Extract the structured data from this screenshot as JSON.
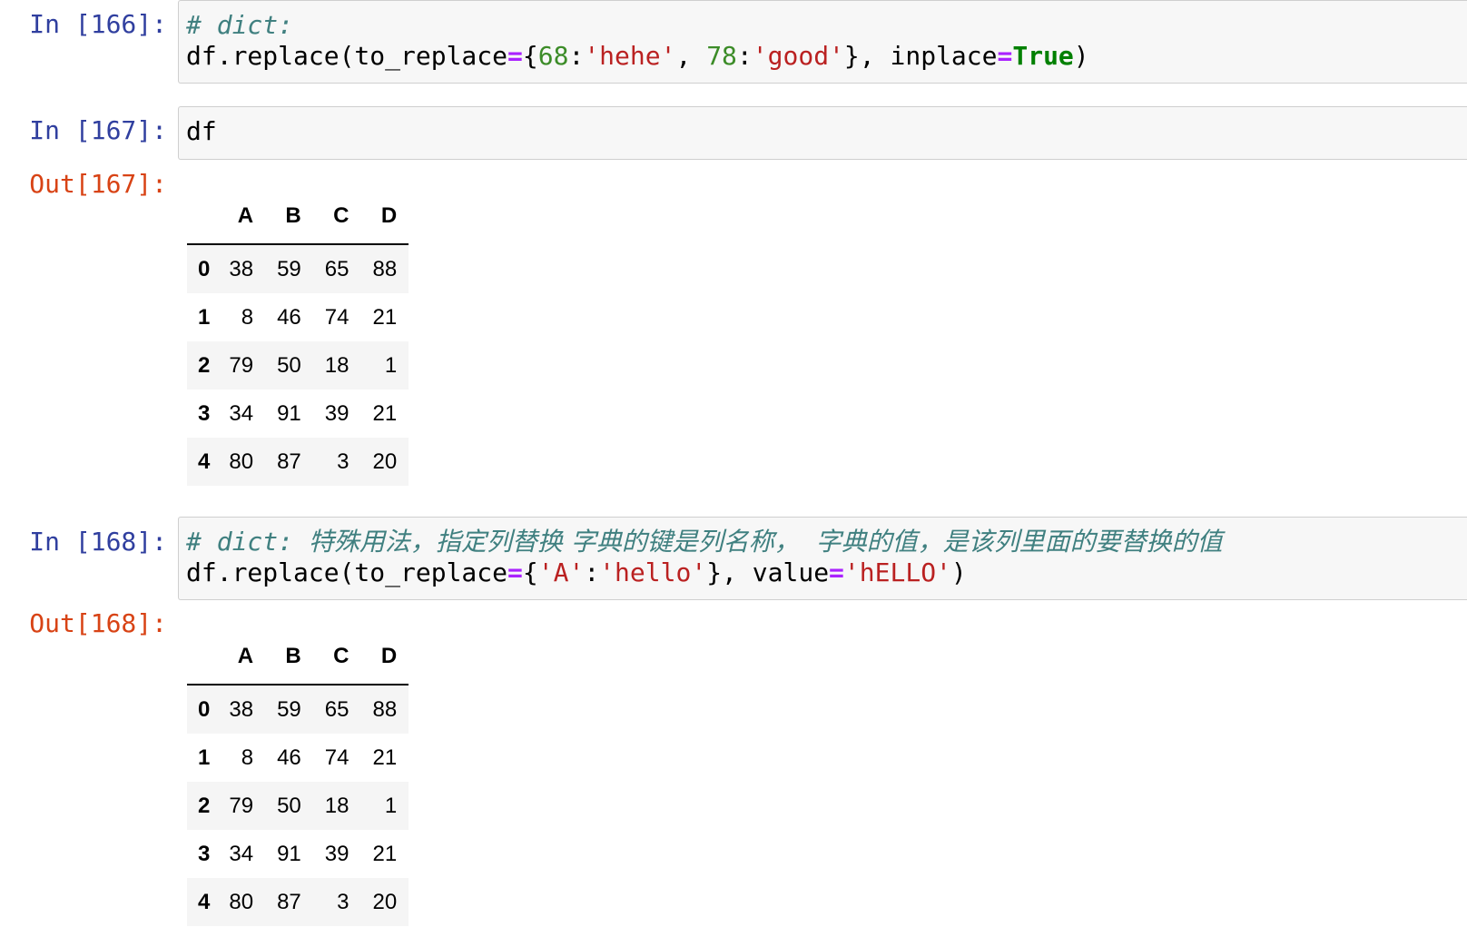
{
  "cells": [
    {
      "in_prompt": "In [166]:",
      "code_lines": [
        [
          {
            "t": "comment",
            "v": "# dict:"
          }
        ],
        [
          {
            "t": "plain",
            "v": "df.replace(to_replace"
          },
          {
            "t": "op",
            "v": "="
          },
          {
            "t": "plain",
            "v": "{"
          },
          {
            "t": "num",
            "v": "68"
          },
          {
            "t": "plain",
            "v": ":"
          },
          {
            "t": "str",
            "v": "'hehe'"
          },
          {
            "t": "plain",
            "v": ", "
          },
          {
            "t": "num",
            "v": "78"
          },
          {
            "t": "plain",
            "v": ":"
          },
          {
            "t": "str",
            "v": "'good'"
          },
          {
            "t": "plain",
            "v": "}, inplace"
          },
          {
            "t": "op",
            "v": "="
          },
          {
            "t": "kw",
            "v": "True"
          },
          {
            "t": "plain",
            "v": ")"
          }
        ]
      ]
    },
    {
      "in_prompt": "In [167]:",
      "code_lines": [
        [
          {
            "t": "plain",
            "v": "df"
          }
        ]
      ],
      "out_prompt": "Out[167]:",
      "table": {
        "columns": [
          "A",
          "B",
          "C",
          "D"
        ],
        "rows": [
          {
            "index": "0",
            "values": [
              "38",
              "59",
              "65",
              "88"
            ]
          },
          {
            "index": "1",
            "values": [
              "8",
              "46",
              "74",
              "21"
            ]
          },
          {
            "index": "2",
            "values": [
              "79",
              "50",
              "18",
              "1"
            ]
          },
          {
            "index": "3",
            "values": [
              "34",
              "91",
              "39",
              "21"
            ]
          },
          {
            "index": "4",
            "values": [
              "80",
              "87",
              "3",
              "20"
            ]
          }
        ]
      }
    },
    {
      "in_prompt": "In [168]:",
      "code_lines": [
        [
          {
            "t": "comment",
            "v": "# dict: "
          },
          {
            "t": "comment-cjk",
            "v": "特殊用法，指定列替换 字典的键是列名称，  字典的值，是该列里面的要替换的值"
          }
        ],
        [
          {
            "t": "plain",
            "v": "df.replace(to_replace"
          },
          {
            "t": "op",
            "v": "="
          },
          {
            "t": "plain",
            "v": "{"
          },
          {
            "t": "str",
            "v": "'A'"
          },
          {
            "t": "plain",
            "v": ":"
          },
          {
            "t": "str",
            "v": "'hello'"
          },
          {
            "t": "plain",
            "v": "}, value"
          },
          {
            "t": "op",
            "v": "="
          },
          {
            "t": "str",
            "v": "'hELLO'"
          },
          {
            "t": "plain",
            "v": ")"
          }
        ]
      ],
      "out_prompt": "Out[168]:",
      "table": {
        "columns": [
          "A",
          "B",
          "C",
          "D"
        ],
        "rows": [
          {
            "index": "0",
            "values": [
              "38",
              "59",
              "65",
              "88"
            ]
          },
          {
            "index": "1",
            "values": [
              "8",
              "46",
              "74",
              "21"
            ]
          },
          {
            "index": "2",
            "values": [
              "79",
              "50",
              "18",
              "1"
            ]
          },
          {
            "index": "3",
            "values": [
              "34",
              "91",
              "39",
              "21"
            ]
          },
          {
            "index": "4",
            "values": [
              "80",
              "87",
              "3",
              "20"
            ]
          }
        ]
      }
    }
  ]
}
